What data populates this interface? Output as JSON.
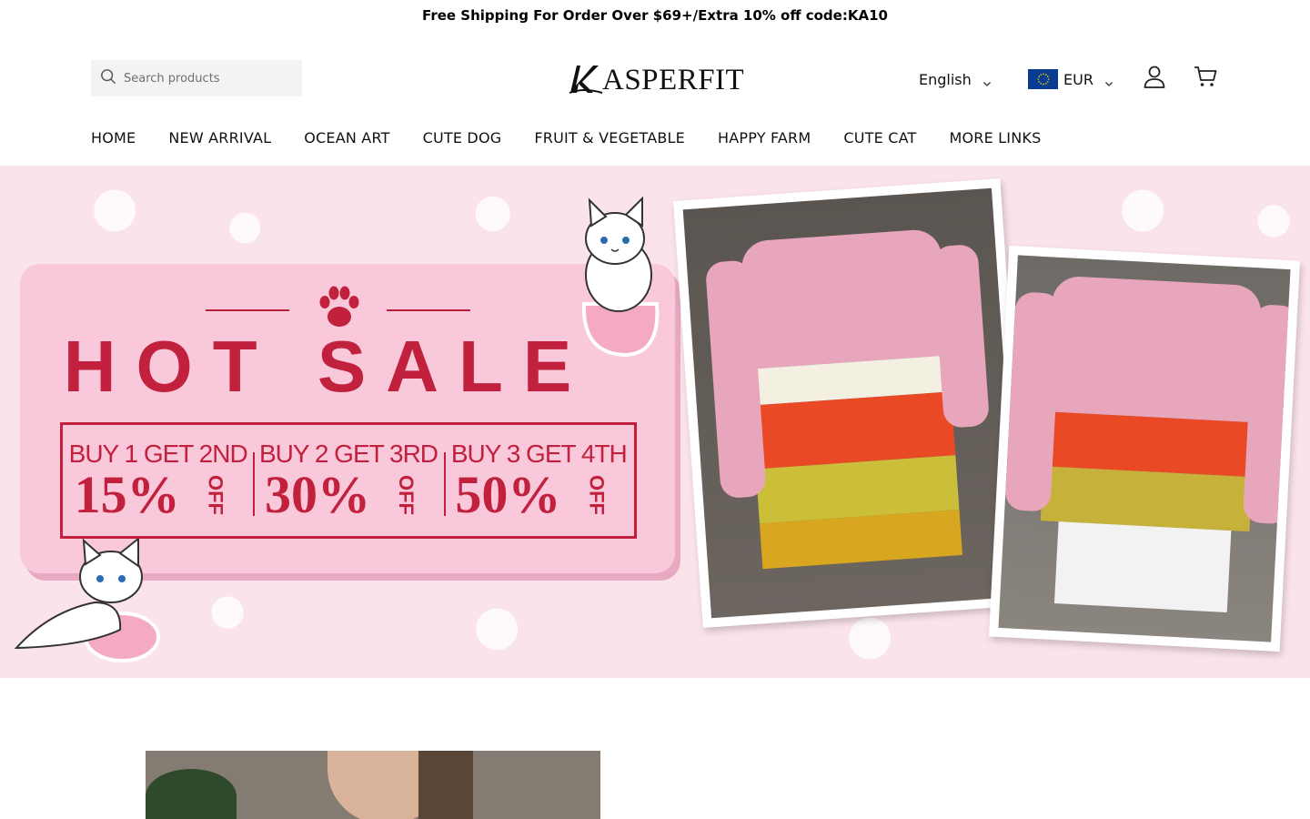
{
  "announcement": "Free Shipping For Order Over $69+/Extra 10% off code:KA10",
  "search": {
    "placeholder": "Search products",
    "icon": "search-icon"
  },
  "brand": {
    "name": "ASPERFIT",
    "logo_icon": "brand-k-logo"
  },
  "header": {
    "language": "English",
    "currency": "EUR",
    "account_icon": "user-icon",
    "cart_icon": "cart-icon"
  },
  "nav": {
    "items": [
      {
        "label": "HOME"
      },
      {
        "label": "NEW ARRIVAL"
      },
      {
        "label": "OCEAN ART"
      },
      {
        "label": "CUTE DOG"
      },
      {
        "label": "FRUIT & VEGETABLE"
      },
      {
        "label": "HAPPY FARM"
      },
      {
        "label": "CUTE CAT"
      },
      {
        "label": "MORE LINKS"
      }
    ]
  },
  "hero": {
    "headline": "HOT SALE",
    "deals": [
      {
        "offer": "BUY 1 GET 2ND",
        "percent": "15%",
        "off": "OFF"
      },
      {
        "offer": "BUY 2 GET 3RD",
        "percent": "30%",
        "off": "OFF"
      },
      {
        "offer": "BUY 3 GET 4TH",
        "percent": "50%",
        "off": "OFF"
      }
    ],
    "colors": {
      "background": "#fbe3ea",
      "panel": "#f9c8db",
      "accent": "#c2213d"
    }
  }
}
